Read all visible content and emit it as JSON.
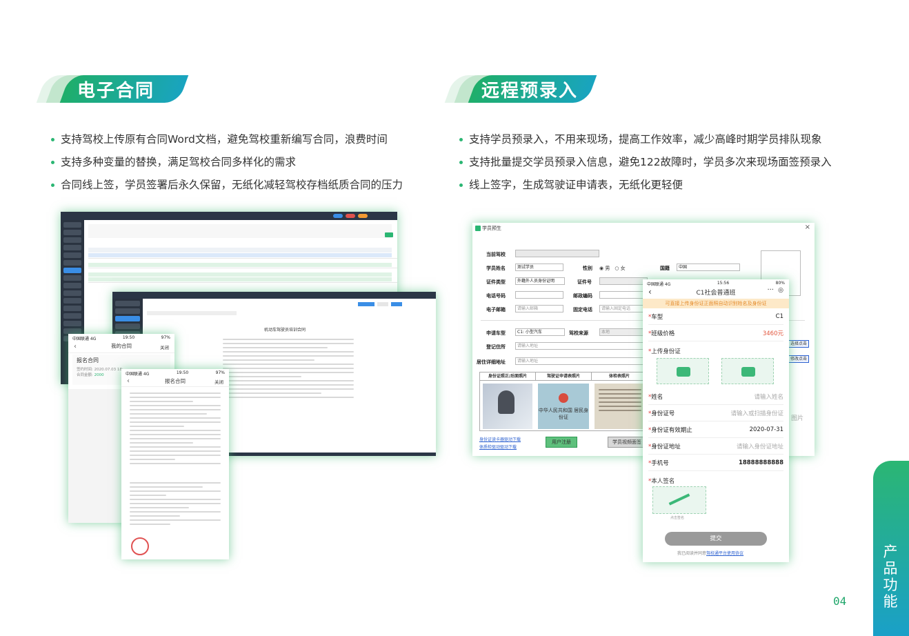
{
  "left_section": {
    "title": "电子合同",
    "bullets": [
      "支持驾校上传原有合同Word文档，避免驾校重新编写合同，浪费时间",
      "支持多种变量的替换，满足驾校合同多样化的需求",
      "合同线上签，学员签署后永久保留，无纸化减轻驾校存档纸质合同的压力"
    ],
    "phone1": {
      "carrier": "中国联通 4G",
      "time": "19:50",
      "battery": "97%",
      "title": "我的合同",
      "close": "关闭",
      "card_title": "报名合同",
      "sign_time_label": "签约时间:",
      "sign_time": "2020.07.03 18:",
      "amount_label": "合同金额:",
      "amount": "2000"
    },
    "phone2": {
      "carrier": "中国联通 4G",
      "time": "19:50",
      "battery": "97%",
      "title": "报名合同",
      "close": "关闭"
    },
    "doc_title": "机动车驾驶员培训合同"
  },
  "right_section": {
    "title": "远程预录入",
    "bullets": [
      "支持学员预录入，不用来现场，提高工作效率，减少高峰时期学员排队现象",
      "支持批量提交学员预录入信息，避免122故障时，学员多次来现场面签预录入",
      "线上签字，生成驾驶证申请表，无纸化更轻便"
    ],
    "form": {
      "window_title": "学员预生",
      "close": "×",
      "labels": {
        "school": "当前驾校",
        "name": "学员姓名",
        "gender": "性别",
        "male": "男",
        "female": "女",
        "nation": "国籍",
        "id_type": "证件类型",
        "id_no": "证件号",
        "phone": "电话号码",
        "zip": "邮政编码",
        "email": "电子邮箱",
        "landline": "固定电话",
        "car_type": "申请车型",
        "source": "驾校来源",
        "reg_addr": "登记住所",
        "live_addr": "居住详细地址"
      },
      "values": {
        "name": "测试学员",
        "nation": "中国",
        "id_type": "外籍外人员身份证明",
        "car_type": "C1: 小型汽车",
        "source": "本地"
      },
      "placeholders": {
        "email": "请输入邮箱",
        "landline": "请输入固定电话",
        "reg_addr": "请输入地址",
        "live_addr": "请输入地址"
      },
      "photo_headers": [
        "身份证照正/后面照片",
        "驾驶证申请表照片",
        "体检表照片"
      ],
      "id_card_text": "中华人民共和国 居民身份证",
      "links": [
        "身份证读卡器驱动下载",
        "体质检驱动驱动下载"
      ],
      "buttons": {
        "register": "用户注册",
        "upload": "学员视频面签"
      }
    },
    "big_phone": {
      "carrier": "中国联通 4G",
      "time": "15:56",
      "battery": "80%",
      "title": "C1社会普通班",
      "notice": "可直接上传身份证正面照自动识别姓名及身份证",
      "car_type_label": "车型",
      "car_type": "C1",
      "price_label": "班级价格",
      "price": "3460元",
      "upload_id_label": "上传身份证",
      "name_label": "姓名",
      "name_placeholder": "请输入姓名",
      "id_label": "身份证号",
      "id_placeholder": "请输入或扫描身份证",
      "valid_label": "身份证有效期止",
      "valid_value": "2020-07-31",
      "addr_label": "身份证地址",
      "addr_placeholder": "请输入身份证地址",
      "mobile_label": "手机号",
      "mobile_value": "18888888888",
      "sign_label": "本人签名",
      "sign_hint": "点击签名",
      "submit": "提交",
      "agree_prefix": "我已阅读并同意",
      "agree_link": "驾校通平台使用协议"
    },
    "peek": {
      "picture": "图片",
      "btn1": "选择点击",
      "btn2": "修改点击"
    }
  },
  "side_tab": "产品功能",
  "page_number": "04",
  "colors": {
    "green": "#2bb673",
    "teal": "#1aa0c8",
    "dark_ui": "#2a3340"
  }
}
